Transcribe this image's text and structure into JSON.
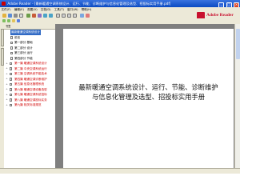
{
  "window": {
    "title": "Adobe Reader - [最新暖通空调系统设计、运行、节能、诊断维护与信息化管理及选型、招投标实用手册.pdf]",
    "controls": [
      "_",
      "□",
      "×"
    ]
  },
  "menubar": {
    "items": [
      "文件(F)",
      "编辑(E)",
      "视图(V)",
      "文档(D)",
      "工具(T)",
      "窗口(W)",
      "帮助(H)"
    ]
  },
  "brand": {
    "name": "Adobe Reader"
  },
  "sidebar": {
    "header": "书签",
    "bookmarks": [
      {
        "label": "最新暖通空调系统设计",
        "state": "selected",
        "expand": ""
      },
      {
        "label": "前言",
        "state": "normal",
        "expand": ""
      },
      {
        "label": "第一部分 基础",
        "state": "normal",
        "expand": ""
      },
      {
        "label": "第二部分 设计",
        "state": "normal",
        "expand": ""
      },
      {
        "label": "第三部分 运行",
        "state": "normal",
        "expand": ""
      },
      {
        "label": "第四部分 节能",
        "state": "normal",
        "expand": ""
      },
      {
        "label": "第一篇 暖通空调系统设计",
        "state": "red",
        "expand": "+"
      },
      {
        "label": "第二篇 中央空调系统运行",
        "state": "red",
        "expand": "+"
      },
      {
        "label": "第三篇 空调系统节能技术",
        "state": "red",
        "expand": "+"
      },
      {
        "label": "第四篇 暖通空调诊断维护",
        "state": "red",
        "expand": "+"
      },
      {
        "label": "第五篇 信息化管理系统",
        "state": "red",
        "expand": "+"
      },
      {
        "label": "第六篇 暖通空调设备选型",
        "state": "red",
        "expand": "+"
      },
      {
        "label": "第七篇 暖通空调系统招标",
        "state": "red",
        "expand": "+"
      },
      {
        "label": "第八篇 暖通空调投标实务",
        "state": "red",
        "expand": "+"
      },
      {
        "label": "第九篇 相关标准规范",
        "state": "red",
        "expand": "+"
      }
    ]
  },
  "document": {
    "title_line1": "最新暖通空调系统设计、运行、节能、诊断维护",
    "title_line2": "与信息化管理及选型、招投标实用手册"
  },
  "statusbar": {
    "text": ""
  },
  "colors": {
    "titlebar": "#0a4ac2",
    "bookmark_red": "#d00000",
    "doc_bg": "#7f7f7f",
    "brand": "#c8102e"
  }
}
